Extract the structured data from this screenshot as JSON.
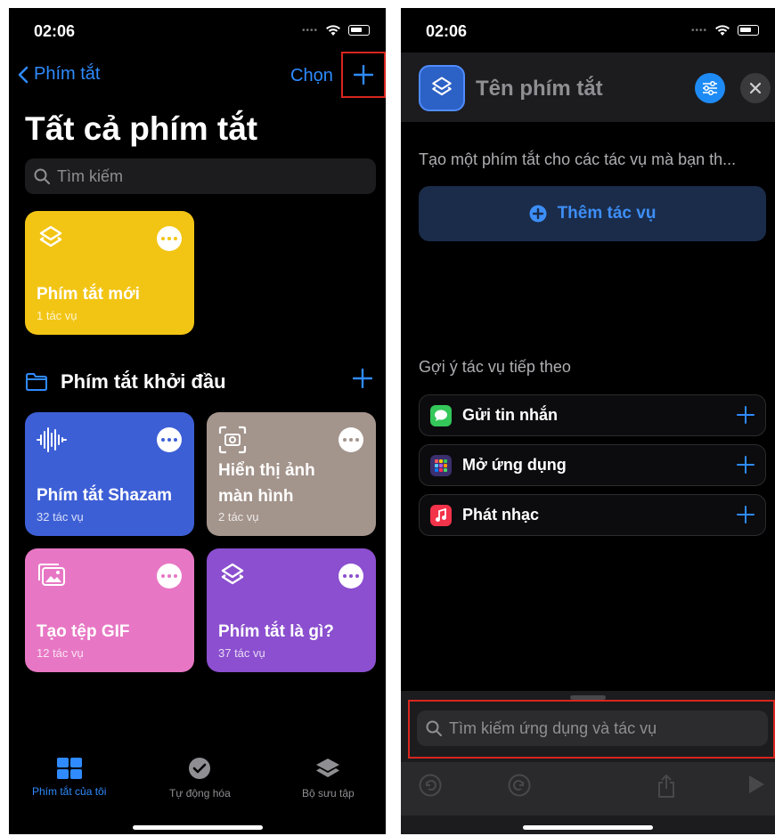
{
  "left": {
    "status": {
      "time": "02:06"
    },
    "nav": {
      "back_label": "Phím tắt",
      "select_label": "Chọn"
    },
    "title": "Tất cả phím tắt",
    "search": {
      "placeholder": "Tìm kiếm"
    },
    "main_card": {
      "name": "Phím tắt mới",
      "count": "1 tác vụ",
      "color": "#f2c515"
    },
    "section": {
      "title": "Phím tắt khởi đầu"
    },
    "starter_cards": [
      {
        "name": "Phím tắt Shazam",
        "count": "32 tác vụ",
        "color": "#3d5fd6",
        "icon": "waveform-icon"
      },
      {
        "name_line1": "Hiển thị ảnh",
        "name_line2": "màn hình",
        "count": "2 tác vụ",
        "color": "#a3948c",
        "icon": "screenshot-icon"
      },
      {
        "name": "Tạo tệp GIF",
        "count": "12 tác vụ",
        "color": "#e777c4",
        "icon": "photos-icon"
      },
      {
        "name": "Phím tắt là gì?",
        "count": "37 tác vụ",
        "color": "#8b4fcf",
        "icon": "layers-icon"
      }
    ],
    "tabs": [
      {
        "label": "Phím tắt của tôi",
        "icon": "grid-icon",
        "active": true
      },
      {
        "label": "Tự động hóa",
        "icon": "clock-check-icon",
        "active": false
      },
      {
        "label": "Bộ sưu tập",
        "icon": "layers-icon",
        "active": false
      }
    ]
  },
  "right": {
    "status": {
      "time": "02:06"
    },
    "shortcut_name": "Tên phím tắt",
    "description": "Tạo một phím tắt cho các tác vụ mà bạn th...",
    "add_action_label": "Thêm tác vụ",
    "suggest_title": "Gợi ý tác vụ tiếp theo",
    "suggestions": [
      {
        "label": "Gửi tin nhắn",
        "icon": "messages-icon",
        "color": "#34c759"
      },
      {
        "label": "Mở ứng dụng",
        "icon": "app-grid-icon",
        "color": "#4a3a8c"
      },
      {
        "label": "Phát nhạc",
        "icon": "music-icon",
        "color": "#f2334a"
      }
    ],
    "search": {
      "placeholder": "Tìm kiếm ứng dụng và tác vụ"
    }
  },
  "colors": {
    "accent": "#2f8bff",
    "highlight": "#d8261f"
  }
}
